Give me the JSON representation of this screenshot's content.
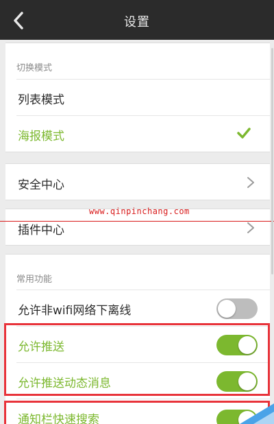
{
  "header": {
    "title": "设置",
    "back_icon": "chevron-left-icon"
  },
  "switch_mode": {
    "section_title": "切换模式",
    "options": [
      {
        "label": "列表模式",
        "selected": false
      },
      {
        "label": "海报模式",
        "selected": true
      }
    ]
  },
  "security": {
    "label": "安全中心"
  },
  "plugins": {
    "label": "插件中心"
  },
  "common": {
    "section_title": "常用功能",
    "items": [
      {
        "label": "允许非wifi网络下离线",
        "enabled": false
      },
      {
        "label": "允许推送",
        "enabled": true
      },
      {
        "label": "允许推送动态消息",
        "enabled": true
      },
      {
        "label": "通知栏快速搜索",
        "enabled": true
      }
    ]
  },
  "watermark": {
    "text": "www.qinpinchang.com"
  },
  "colors": {
    "accent": "#7cb82f",
    "titlebar": "#2b2b2b",
    "highlight": "#e8333a",
    "watermark": "#d81a1a",
    "toggle_off": "#bdbdbd"
  }
}
